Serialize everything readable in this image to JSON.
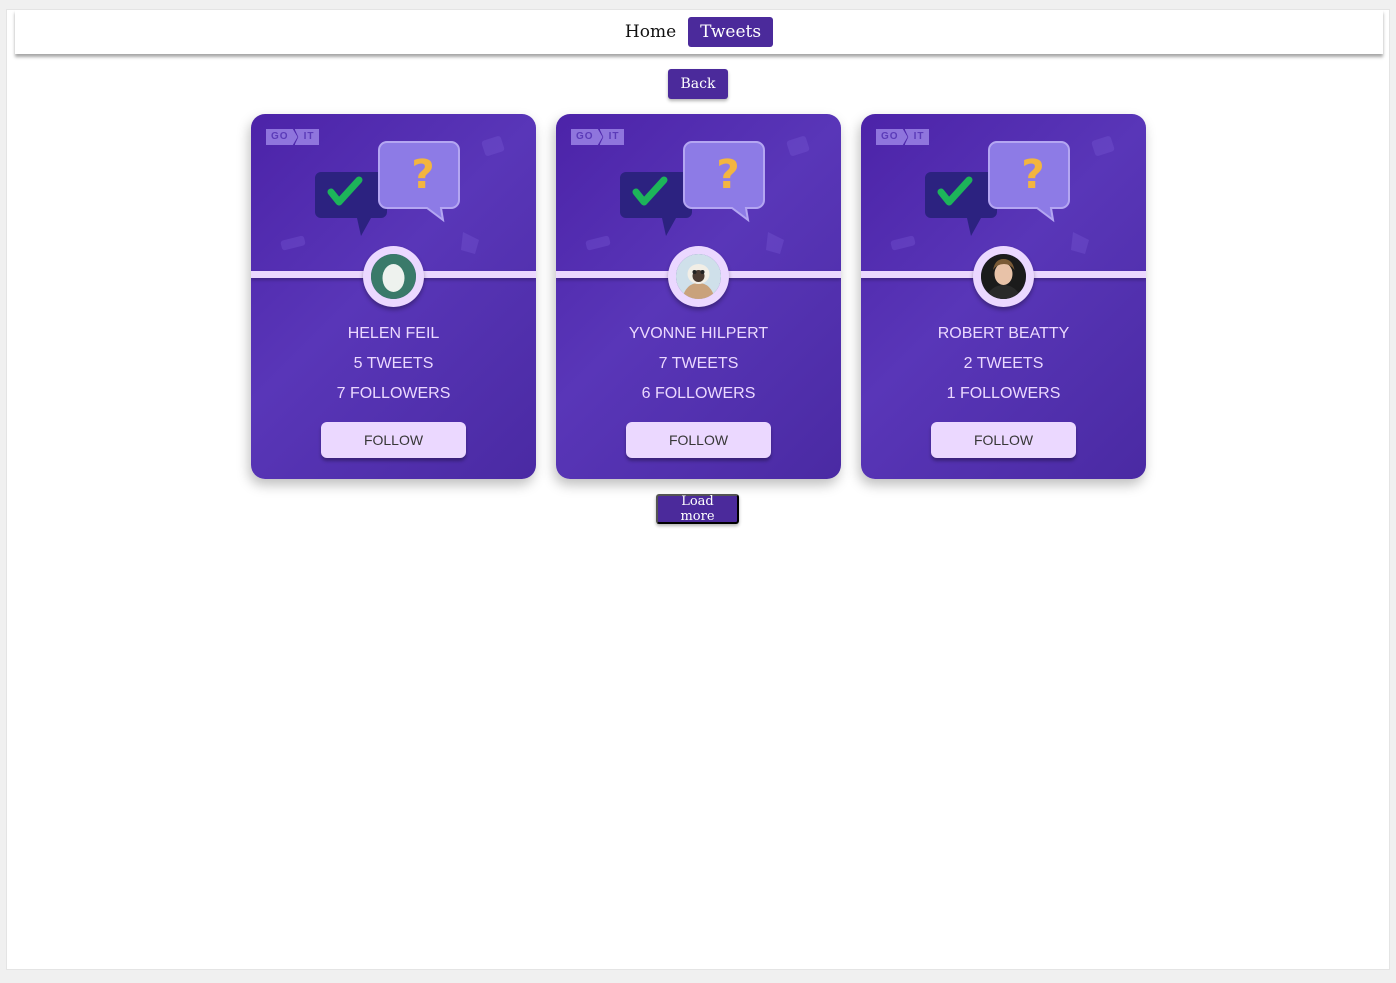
{
  "nav": {
    "home_label": "Home",
    "tweets_label": "Tweets"
  },
  "back_label": "Back",
  "load_more_label": "Load more",
  "logo": {
    "left": "GO",
    "right": "IT"
  },
  "users": [
    {
      "name": "HELEN FEIL",
      "tweets": "5 TWEETS",
      "followers": "7 FOLLOWERS",
      "button": "FOLLOW",
      "avatar": "egg-avatar"
    },
    {
      "name": "YVONNE HILPERT",
      "tweets": "7 TWEETS",
      "followers": "6 FOLLOWERS",
      "button": "FOLLOW",
      "avatar": "lemur-avatar"
    },
    {
      "name": "ROBERT BEATTY",
      "tweets": "2 TWEETS",
      "followers": "1 FOLLOWERS",
      "button": "FOLLOW",
      "avatar": "person-avatar"
    }
  ],
  "colors": {
    "accent": "#4b2a9b",
    "card_bg": "#5736a3",
    "light_lavender": "#ebd8ff"
  }
}
